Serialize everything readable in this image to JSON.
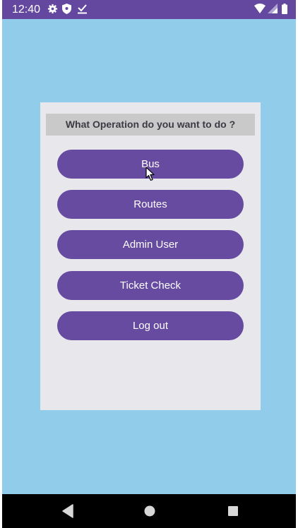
{
  "status_bar": {
    "time": "12:40",
    "icons": [
      "gear-icon",
      "shield-icon",
      "download-done-icon",
      "wifi-icon",
      "signal-icon",
      "battery-icon"
    ]
  },
  "card": {
    "title": "What Operation do you want to do ?",
    "buttons": [
      "Bus",
      "Routes",
      "Admin User",
      "Ticket Check",
      "Log out"
    ]
  },
  "navigation": {
    "icons": [
      "back-icon",
      "home-icon",
      "recents-icon"
    ]
  },
  "colors": {
    "background": "#91cdea",
    "status_bar": "#6448a0",
    "button": "#664ba0",
    "card": "#e8e8ec",
    "title_bar": "#c9c9c9"
  }
}
